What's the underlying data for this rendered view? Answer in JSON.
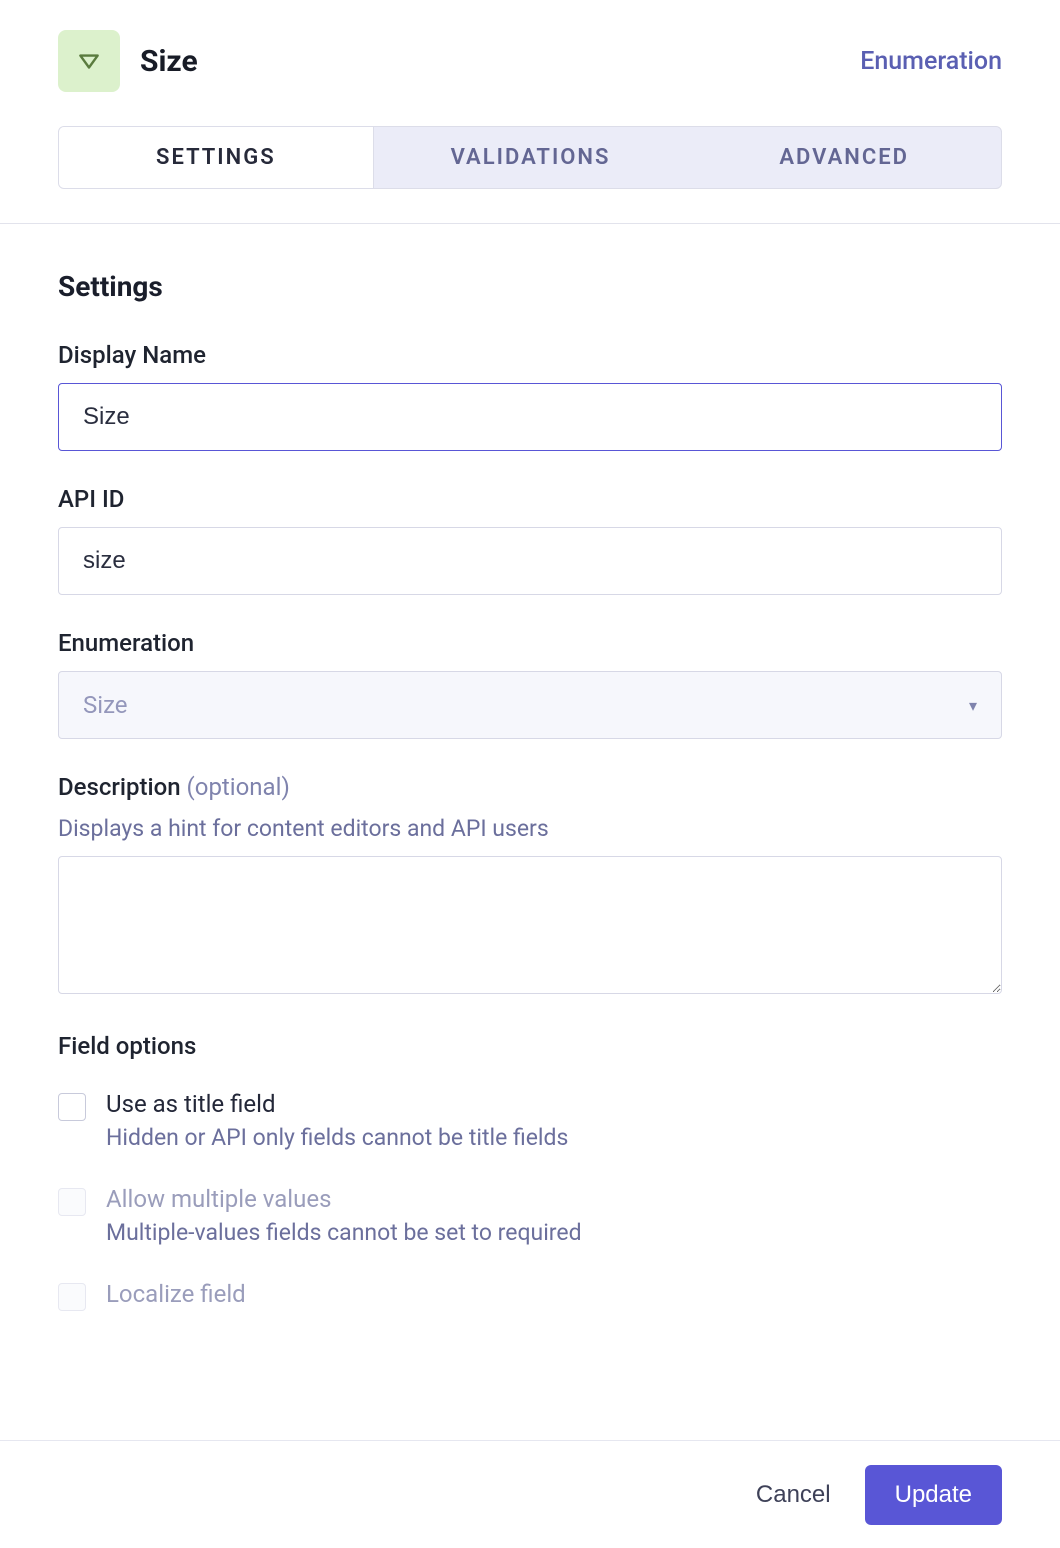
{
  "header": {
    "title": "Size",
    "type_badge": "Enumeration"
  },
  "tabs": {
    "settings": "SETTINGS",
    "validations": "VALIDATIONS",
    "advanced": "ADVANCED"
  },
  "settings": {
    "heading": "Settings",
    "display_name": {
      "label": "Display Name",
      "value": "Size"
    },
    "api_id": {
      "label": "API ID",
      "value": "size"
    },
    "enumeration": {
      "label": "Enumeration",
      "selected": "Size"
    },
    "description": {
      "label": "Description",
      "optional": "(optional)",
      "hint": "Displays a hint for content editors and API users",
      "value": ""
    },
    "field_options": {
      "heading": "Field options",
      "title_field": {
        "label": "Use as title field",
        "sub": "Hidden or API only fields cannot be title fields"
      },
      "multiple": {
        "label": "Allow multiple values",
        "sub": "Multiple-values fields cannot be set to required"
      },
      "localize": {
        "label": "Localize field"
      }
    }
  },
  "footer": {
    "cancel": "Cancel",
    "update": "Update"
  }
}
